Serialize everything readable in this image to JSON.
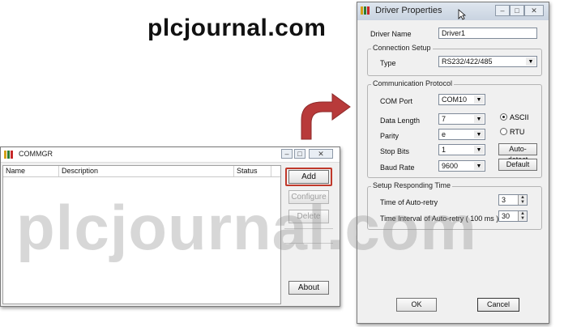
{
  "site_title": "plcjournal.com",
  "watermark": "plcjournal.com",
  "commgr": {
    "title": "COMMGR",
    "columns": [
      "Name",
      "Description",
      "Status"
    ],
    "buttons": {
      "add": "Add",
      "configure": "Configure",
      "delete": "Delete",
      "about": "About"
    }
  },
  "driver": {
    "title": "Driver Properties",
    "driver_name_label": "Driver Name",
    "driver_name_value": "Driver1",
    "connection_setup": {
      "title": "Connection Setup",
      "type_label": "Type",
      "type_value": "RS232/422/485"
    },
    "communication_protocol": {
      "title": "Communication Protocol",
      "com_port_label": "COM Port",
      "com_port_value": "COM10",
      "data_length_label": "Data Length",
      "data_length_value": "7",
      "parity_label": "Parity",
      "parity_value": "e",
      "stop_bits_label": "Stop Bits",
      "stop_bits_value": "1",
      "baud_rate_label": "Baud Rate",
      "baud_rate_value": "9600",
      "ascii_label": "ASCII",
      "rtu_label": "RTU",
      "selected_mode": "ASCII",
      "auto_detect_label": "Auto-detect",
      "default_label": "Default"
    },
    "responding_time": {
      "title": "Setup Responding Time",
      "auto_retry_label": "Time of Auto-retry",
      "auto_retry_value": "3",
      "interval_label": "Time Interval of Auto-retry ( 100 ms )",
      "interval_value": "30"
    },
    "ok_label": "OK",
    "cancel_label": "Cancel"
  },
  "colors": {
    "arrow": "#b83a3a",
    "highlight": "#c0392b",
    "titlebar": "#cdd6e2"
  }
}
